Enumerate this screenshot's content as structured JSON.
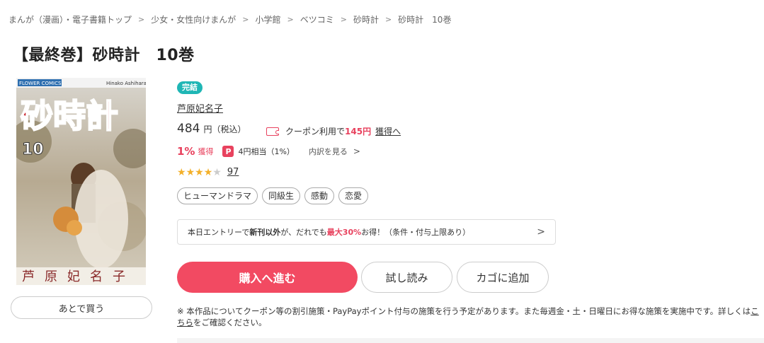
{
  "breadcrumb": [
    {
      "label": "まんが（漫画）・電子書籍トップ"
    },
    {
      "label": "少女・女性向けまんが"
    },
    {
      "label": "小学館"
    },
    {
      "label": "ベツコミ"
    },
    {
      "label": "砂時計"
    },
    {
      "label": "砂時計　10巻"
    }
  ],
  "separator": ">",
  "title": "【最終巻】砂時計　10巻",
  "cover": {
    "publisher_badge": "FLOWER COMICS",
    "series_title": "砂時計",
    "volume": "10",
    "author_romaji": "Hinako Ashihara",
    "author_kanji": "芦原妃名子"
  },
  "later_button": "あとで買う",
  "status_badge": "完結",
  "author": "芦原妃名子",
  "price": {
    "value": "484",
    "unit": "円（税込）"
  },
  "coupon": {
    "prefix": "クーポン利用で",
    "price": "145円",
    "link": "獲得へ"
  },
  "points": {
    "percent": "1%",
    "percent_label": "獲得",
    "equiv": "4円相当（1%）",
    "breakdown": "内訳を見る",
    "paypay_glyph": "P"
  },
  "rating": {
    "value": 4,
    "max": 5,
    "count": "97"
  },
  "tags": [
    "ヒューマンドラマ",
    "同級生",
    "感動",
    "恋愛"
  ],
  "campaign": {
    "part1": "本日エントリーで",
    "part2": "新刊以外",
    "part3": "が、だれでも",
    "part4": "最大30%",
    "part5": "お得！（条件・付与上限あり）"
  },
  "buttons": {
    "buy": "購入へ進む",
    "sample": "試し読み",
    "cart": "カゴに追加"
  },
  "note": {
    "text1": "※ 本作品についてクーポン等の割引施策・PayPayポイント付与の施策を行う予定があります。また毎週金・土・日曜日にお得な施策を実施中です。詳しくは",
    "link": "こちら",
    "text2": "をご確認ください。"
  },
  "colors": {
    "accent": "#f24a62",
    "badge": "#1fb6b5",
    "star": "#f3b02a"
  }
}
